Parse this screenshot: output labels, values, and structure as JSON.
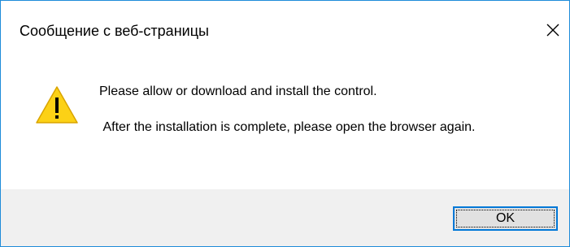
{
  "window": {
    "title": "Сообщение с веб-страницы",
    "close_icon": "close-icon",
    "accent_color": "#1e8cd9"
  },
  "message": {
    "icon": "warning-icon",
    "icon_color": "#fcd116",
    "line1": "Please allow or download and install the control.",
    "line2": " After the installation is complete, please open the browser again."
  },
  "footer": {
    "ok_label": "OK"
  }
}
